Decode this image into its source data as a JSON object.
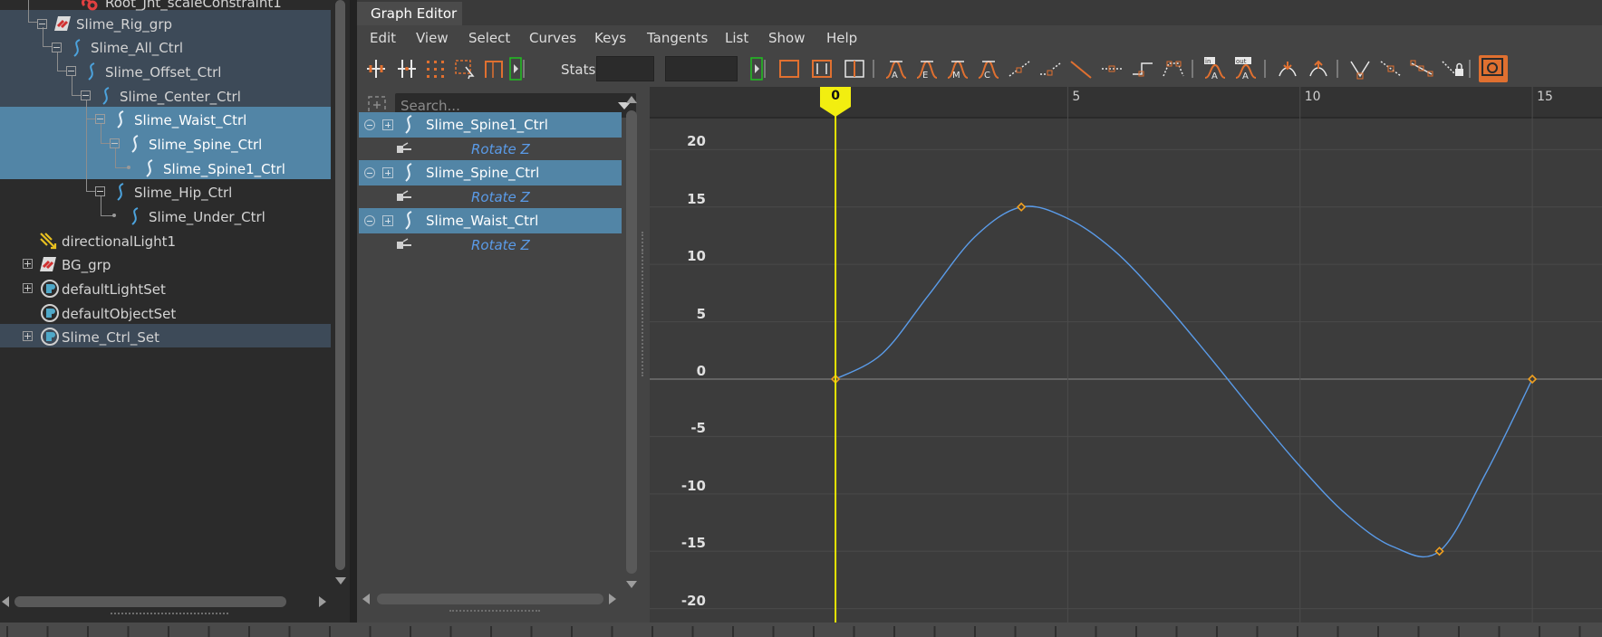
{
  "outliner": {
    "items": [
      {
        "label": "Root_Jnt_scaleConstraint1",
        "icon": "constraint-icon"
      },
      {
        "label": "Slime_Rig_grp",
        "icon": "group-icon"
      },
      {
        "label": "Slime_All_Ctrl",
        "icon": "nurbs-curve-icon"
      },
      {
        "label": "Slime_Offset_Ctrl",
        "icon": "nurbs-curve-icon"
      },
      {
        "label": "Slime_Center_Ctrl",
        "icon": "nurbs-curve-icon"
      },
      {
        "label": "Slime_Waist_Ctrl",
        "icon": "nurbs-curve-icon"
      },
      {
        "label": "Slime_Spine_Ctrl",
        "icon": "nurbs-curve-icon"
      },
      {
        "label": "Slime_Spine1_Ctrl",
        "icon": "nurbs-curve-icon"
      },
      {
        "label": "Slime_Hip_Ctrl",
        "icon": "nurbs-curve-icon"
      },
      {
        "label": "Slime_Under_Ctrl",
        "icon": "nurbs-curve-icon"
      },
      {
        "label": "directionalLight1",
        "icon": "directional-light-icon"
      },
      {
        "label": "BG_grp",
        "icon": "group-icon"
      },
      {
        "label": "defaultLightSet",
        "icon": "set-icon"
      },
      {
        "label": "defaultObjectSet",
        "icon": "set-icon"
      },
      {
        "label": "Slime_Ctrl_Set",
        "icon": "set-icon"
      }
    ]
  },
  "graph_editor": {
    "tab_title": "Graph Editor",
    "menus": [
      "Edit",
      "View",
      "Select",
      "Curves",
      "Keys",
      "Tangents",
      "List",
      "Show",
      "Help"
    ],
    "toolbar": {
      "stats_label": "Stats",
      "stats_value_1": "",
      "stats_value_2": ""
    },
    "channel_search_placeholder": "Search...",
    "channels": [
      {
        "object": "Slime_Spine1_Ctrl",
        "attribute": "Rotate Z"
      },
      {
        "object": "Slime_Spine_Ctrl",
        "attribute": "Rotate Z"
      },
      {
        "object": "Slime_Waist_Ctrl",
        "attribute": "Rotate Z"
      }
    ],
    "current_frame": "0",
    "colors": {
      "selection": "#5285a6",
      "curve": "#5a9be8",
      "key": "#f0a020",
      "time_cursor": "#e8e600",
      "attribute_text": "#5a9be8"
    }
  },
  "chart_data": {
    "type": "line",
    "x_ticks": [
      "5",
      "10",
      "15"
    ],
    "y_ticks": [
      "20",
      "15",
      "10",
      "5",
      "0",
      "-5",
      "-10",
      "-15",
      "-20"
    ],
    "xlim": [
      -4,
      16.5
    ],
    "ylim": [
      -22,
      22
    ],
    "series": [
      {
        "keys": [
          {
            "x": 0,
            "y": 0
          },
          {
            "x": 4,
            "y": 15
          },
          {
            "x": 13,
            "y": -15
          },
          {
            "x": 15,
            "y": 0
          }
        ],
        "samples": [
          [
            0,
            0
          ],
          [
            1,
            2.2
          ],
          [
            2,
            7.3
          ],
          [
            3,
            12.4
          ],
          [
            4,
            15
          ],
          [
            5,
            14.0
          ],
          [
            6,
            11.2
          ],
          [
            7,
            7.0
          ],
          [
            8,
            2.2
          ],
          [
            9,
            -2.8
          ],
          [
            10,
            -7.6
          ],
          [
            11,
            -11.8
          ],
          [
            12,
            -14.6
          ],
          [
            13,
            -15
          ],
          [
            14,
            -8.2
          ],
          [
            15,
            0
          ]
        ]
      }
    ]
  }
}
